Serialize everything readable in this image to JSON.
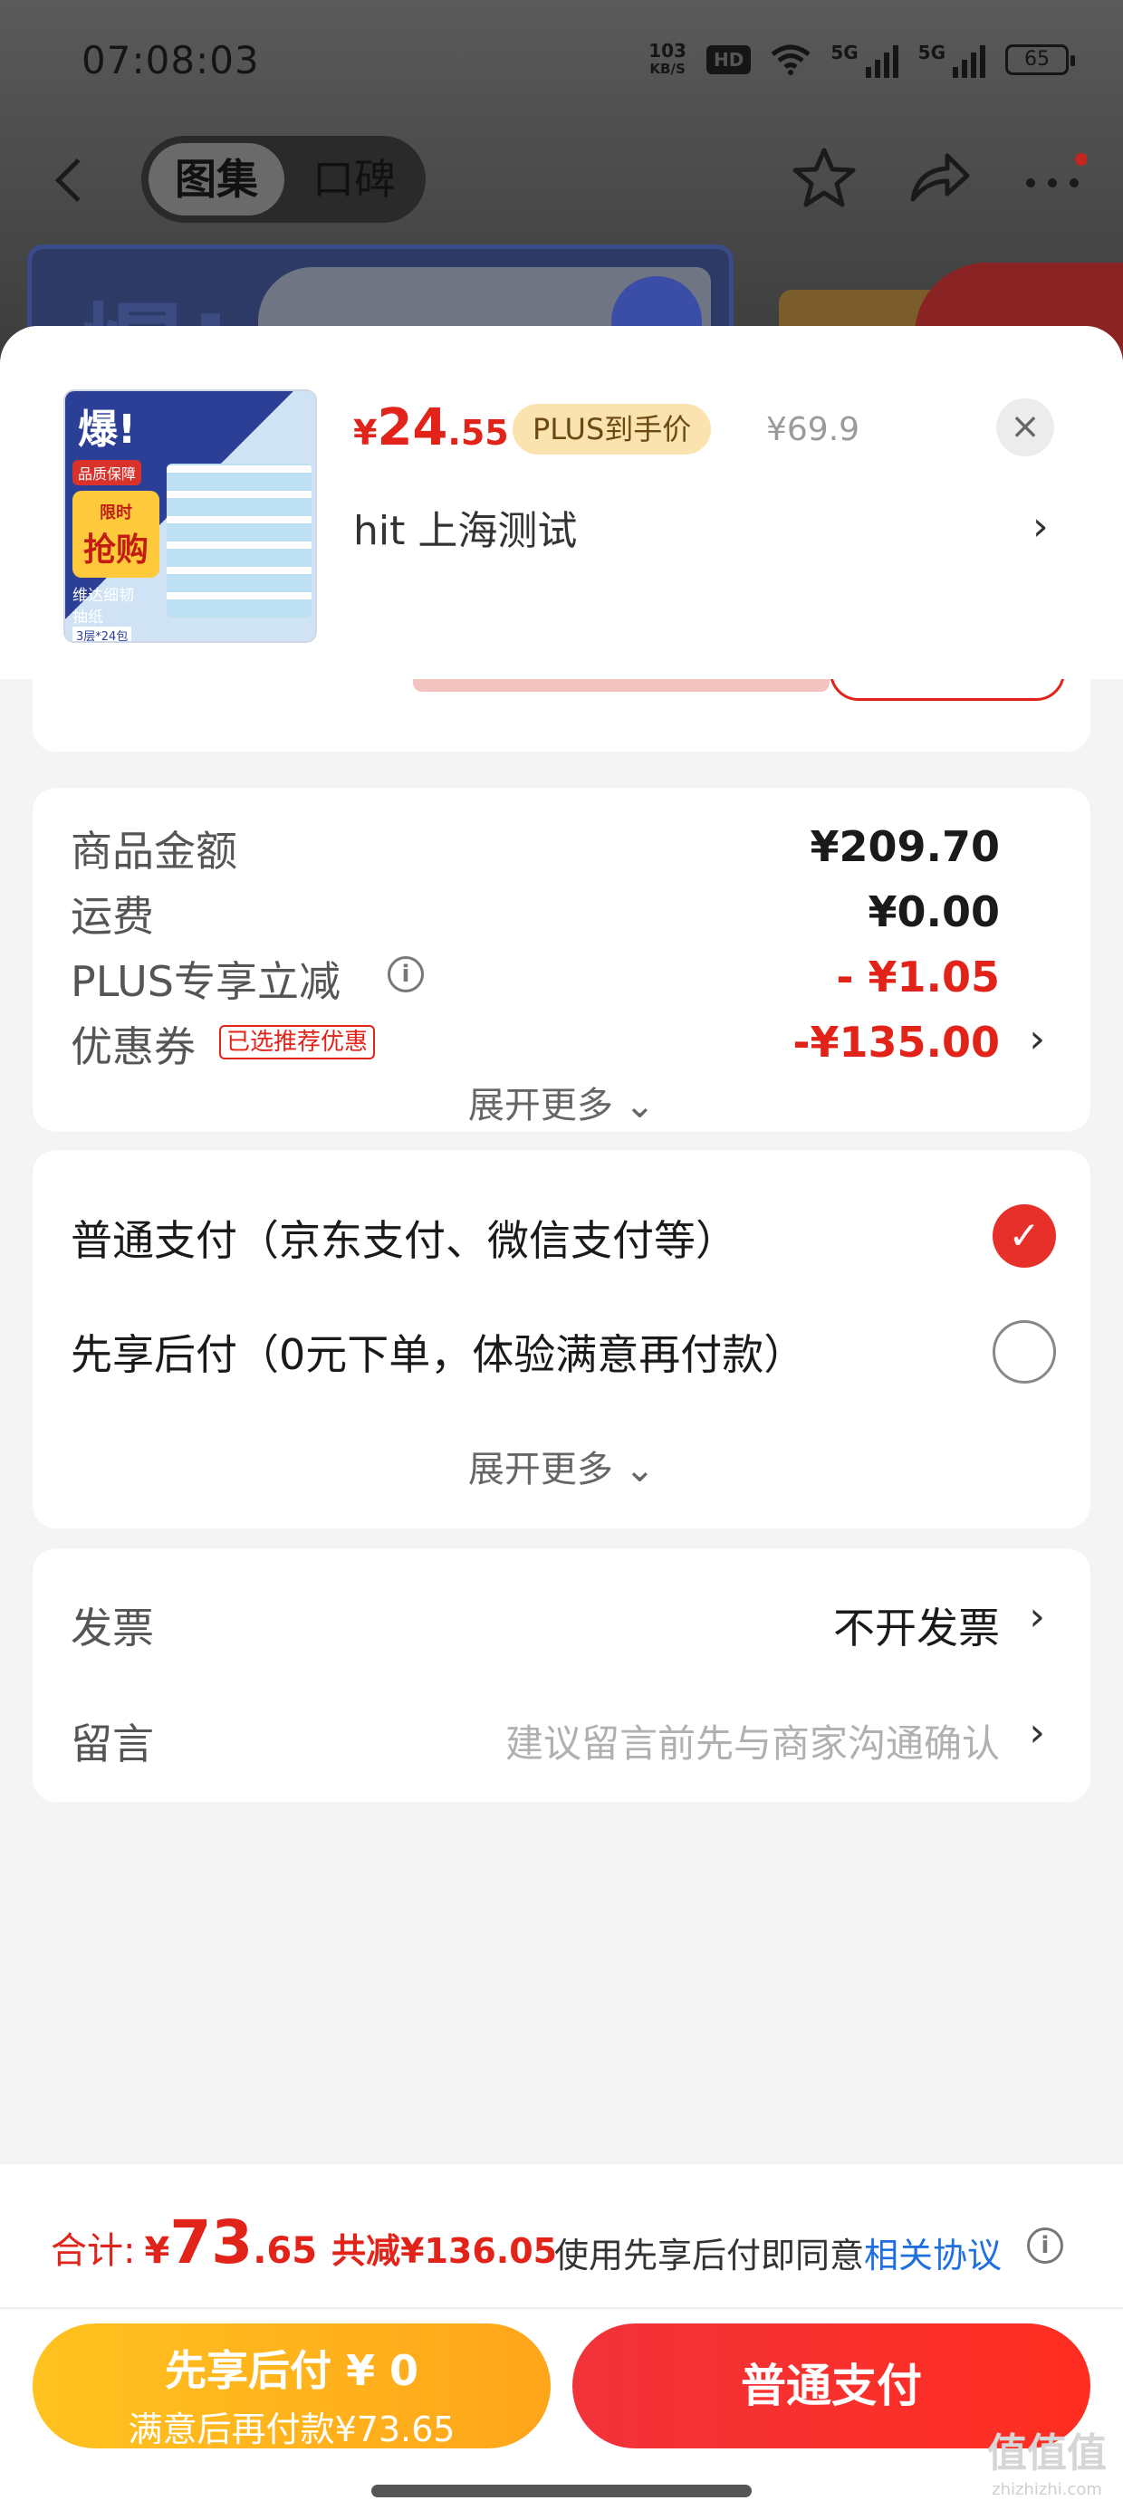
{
  "status_bar": {
    "time": "07:08:03",
    "net_speed_value": "103",
    "net_speed_unit": "KB/S",
    "hd": "HD",
    "sig1_label": "5G",
    "sig2_label": "5G",
    "battery": "65"
  },
  "nav": {
    "tabs": [
      "图集",
      "口碑"
    ],
    "active_tab": "图集"
  },
  "banner": {
    "text": "爆!"
  },
  "product": {
    "thumb_text": "爆!",
    "thumb_tag_top": "品质保障",
    "thumb_tag_limited": "限时",
    "thumb_tag_rush": "抢购",
    "thumb_line1": "维达细韧",
    "thumb_line2": "抽纸",
    "thumb_spec": "3层*24包",
    "price_symbol": "¥",
    "price_int": "24",
    "price_dec": ".55",
    "plus_badge": "PLUS到手价",
    "orig_price": "¥69.9",
    "close": "×",
    "address": "hit  上海测试",
    "address_chevron": "›"
  },
  "summary": {
    "goods_amount_label": "商品金额",
    "goods_amount_value": "¥209.70",
    "shipping_label": "运费",
    "shipping_value": "¥0.00",
    "plus_discount_label": "PLUS专享立减",
    "plus_discount_value": "- ¥1.05",
    "coupon_label": "优惠券",
    "coupon_tag": "已选推荐优惠",
    "coupon_value": "-¥135.00",
    "expand_more": "展开更多 ⌄"
  },
  "payment": {
    "option1": "普通支付（京东支付、微信支付等）",
    "option2": "先享后付（0元下单，体验满意再付款）",
    "option1_selected": true,
    "expand_more": "展开更多 ⌄"
  },
  "extras": {
    "invoice_label": "发票",
    "invoice_value": "不开发票",
    "message_label": "留言",
    "message_placeholder": "建议留言前先与商家沟通确认"
  },
  "footer": {
    "total_label": "合计:",
    "total_symbol": "¥",
    "total_int": "73",
    "total_dec": ".65",
    "total_saved": "共减¥136.05",
    "agree_text": "使用先享后付即同意",
    "agree_link": "相关协议",
    "btn_later_line1": "先享后付 ¥ 0",
    "btn_later_line2": "满意后再付款¥73.65",
    "btn_pay": "普通支付",
    "watermark": "值值值",
    "watermark_url": "zhizhizhi.com"
  },
  "colors": {
    "accent_red": "#e2231a",
    "pay_button": "#f2333a",
    "later_button": "#ffb31c",
    "link_blue": "#1e6fe0"
  }
}
